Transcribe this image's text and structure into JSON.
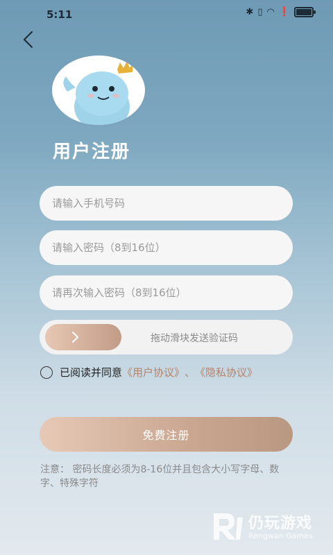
{
  "status_bar": {
    "time": "5:11",
    "icons": [
      "bluetooth-icon",
      "vibrate-icon",
      "wifi-icon",
      "alert-icon",
      "battery-icon"
    ]
  },
  "header": {
    "back_icon": "chevron-left-icon"
  },
  "title": "用户注册",
  "form": {
    "phone_placeholder": "请输入手机号码",
    "password_placeholder": "请输入密码（8到16位）",
    "confirm_placeholder": "请再次输入密码（8到16位）"
  },
  "slider": {
    "label": "拖动滑块发送验证码"
  },
  "agreement": {
    "prefix": "已阅读并同意",
    "user_link": "《用户协议》",
    "separator": "、",
    "privacy_link": "《隐私协议》"
  },
  "register_button": "免费注册",
  "note": "注意：  密码长度必须为8-16位并且包含大小写字母、数字、特殊字符",
  "watermark": {
    "cn": "仍玩游戏",
    "en": "Rengwan Games"
  },
  "colors": {
    "accent": "#b5826a",
    "button_start": "#e6c9b6",
    "button_end": "#b99882",
    "title": "#ffffff"
  }
}
